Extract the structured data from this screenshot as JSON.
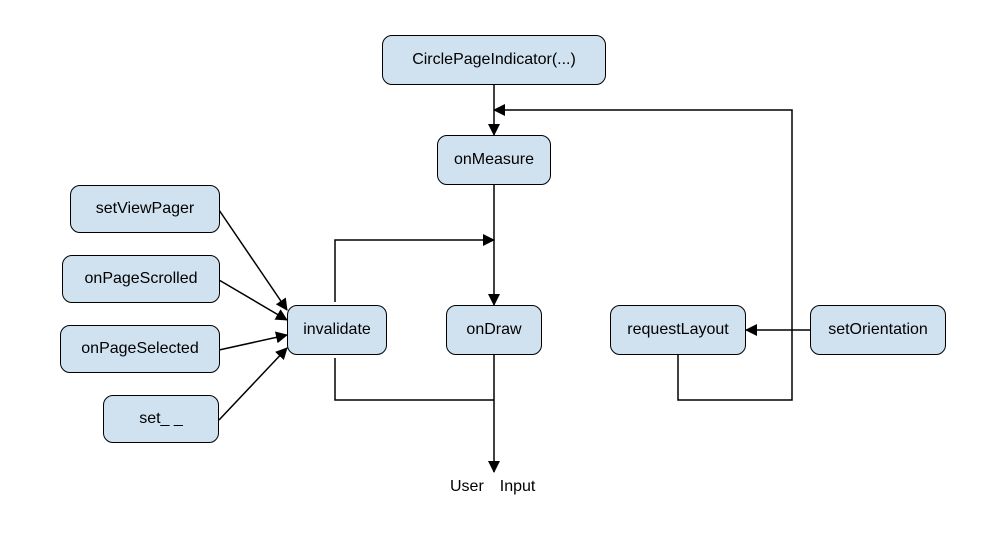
{
  "diagram": {
    "type": "flowchart",
    "nodes": {
      "constructor": {
        "label": "CirclePageIndicator(...)"
      },
      "onMeasure": {
        "label": "onMeasure"
      },
      "onDraw": {
        "label": "onDraw"
      },
      "invalidate": {
        "label": "invalidate"
      },
      "requestLayout": {
        "label": "requestLayout"
      },
      "setOrientation": {
        "label": "setOrientation"
      },
      "setViewPager": {
        "label": "setViewPager"
      },
      "onPageScrolled": {
        "label": "onPageScrolled"
      },
      "onPageSelected": {
        "label": "onPageSelected"
      },
      "setBlank": {
        "label": "set_ _"
      }
    },
    "output_label": "User Input",
    "edges": [
      {
        "from": "constructor",
        "to": "onMeasure"
      },
      {
        "from": "onMeasure",
        "to": "onDraw"
      },
      {
        "from": "onDraw",
        "to": "output"
      },
      {
        "from": "setViewPager",
        "to": "invalidate"
      },
      {
        "from": "onPageScrolled",
        "to": "invalidate"
      },
      {
        "from": "onPageSelected",
        "to": "invalidate"
      },
      {
        "from": "setBlank",
        "to": "invalidate"
      },
      {
        "from": "invalidate",
        "to": "onDraw",
        "style": "routed"
      },
      {
        "from": "setOrientation",
        "to": "requestLayout"
      },
      {
        "from": "requestLayout",
        "to": "onMeasure",
        "style": "routed"
      }
    ],
    "colors": {
      "node_fill": "#d0e2f0",
      "node_stroke": "#000000",
      "edge": "#000000"
    }
  }
}
